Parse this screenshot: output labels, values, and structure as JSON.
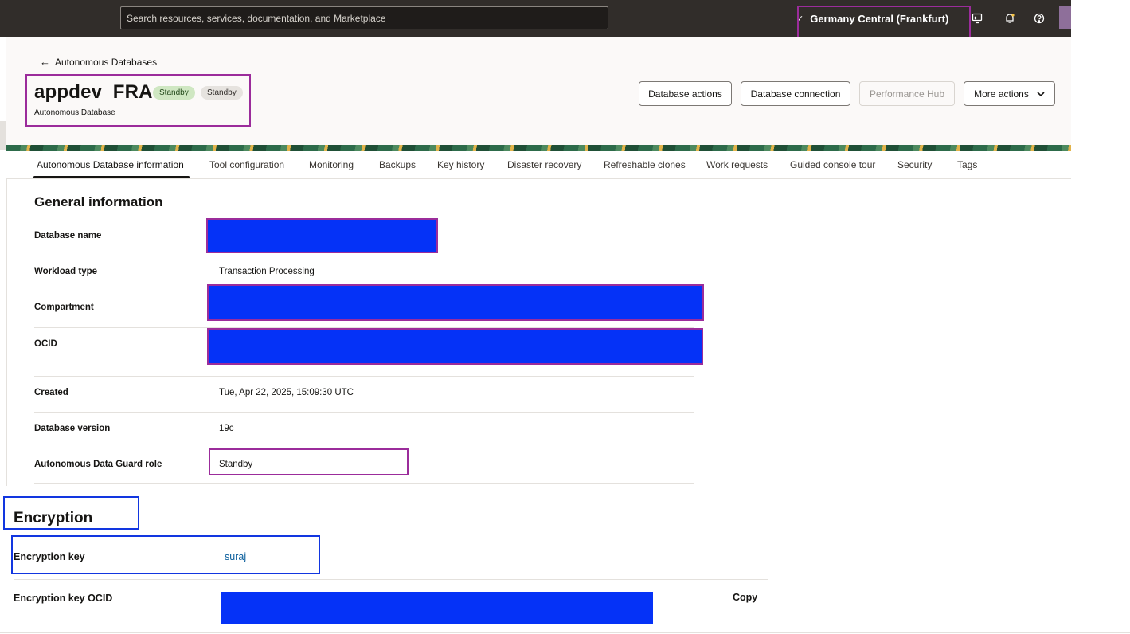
{
  "topbar": {
    "search_placeholder": "Search resources, services, documentation, and Marketplace",
    "region": "Germany Central (Frankfurt)",
    "icons": [
      "cloud-shell-icon",
      "bell-icon",
      "help-icon",
      "avatar"
    ]
  },
  "header": {
    "back_label": "Autonomous Databases",
    "title": "appdev_FRA",
    "badges": [
      "Standby",
      "Standby"
    ],
    "subtitle": "Autonomous Database",
    "actions": {
      "database_actions": "Database actions",
      "database_connection": "Database connection",
      "performance_hub": "Performance Hub",
      "more_actions": "More actions"
    }
  },
  "tabs": [
    "Autonomous Database information",
    "Tool configuration",
    "Monitoring",
    "Backups",
    "Key history",
    "Disaster recovery",
    "Refreshable clones",
    "Work requests",
    "Guided console tour",
    "Security",
    "Tags"
  ],
  "general": {
    "title": "General information",
    "rows": [
      {
        "label": "Database name",
        "value": ""
      },
      {
        "label": "Workload type",
        "value": "Transaction Processing"
      },
      {
        "label": "Compartment",
        "value": ""
      },
      {
        "label": "OCID",
        "value": ""
      },
      {
        "label": "Created",
        "value": "Tue, Apr 22, 2025, 15:09:30 UTC"
      },
      {
        "label": "Database version",
        "value": "19c"
      },
      {
        "label": "Autonomous Data Guard role",
        "value": "Standby"
      }
    ]
  },
  "encryption": {
    "title": "Encryption",
    "key_label": "Encryption key",
    "key_value": "suraj",
    "key_ocid_label": "Encryption key OCID",
    "copy_label": "Copy"
  },
  "colors": {
    "topbar": "#312d2a",
    "highlight_purple": "#9b2c9b",
    "highlight_blue": "#1236e0",
    "redaction": "#0532f7",
    "badge_green": "#cfe7c2"
  }
}
